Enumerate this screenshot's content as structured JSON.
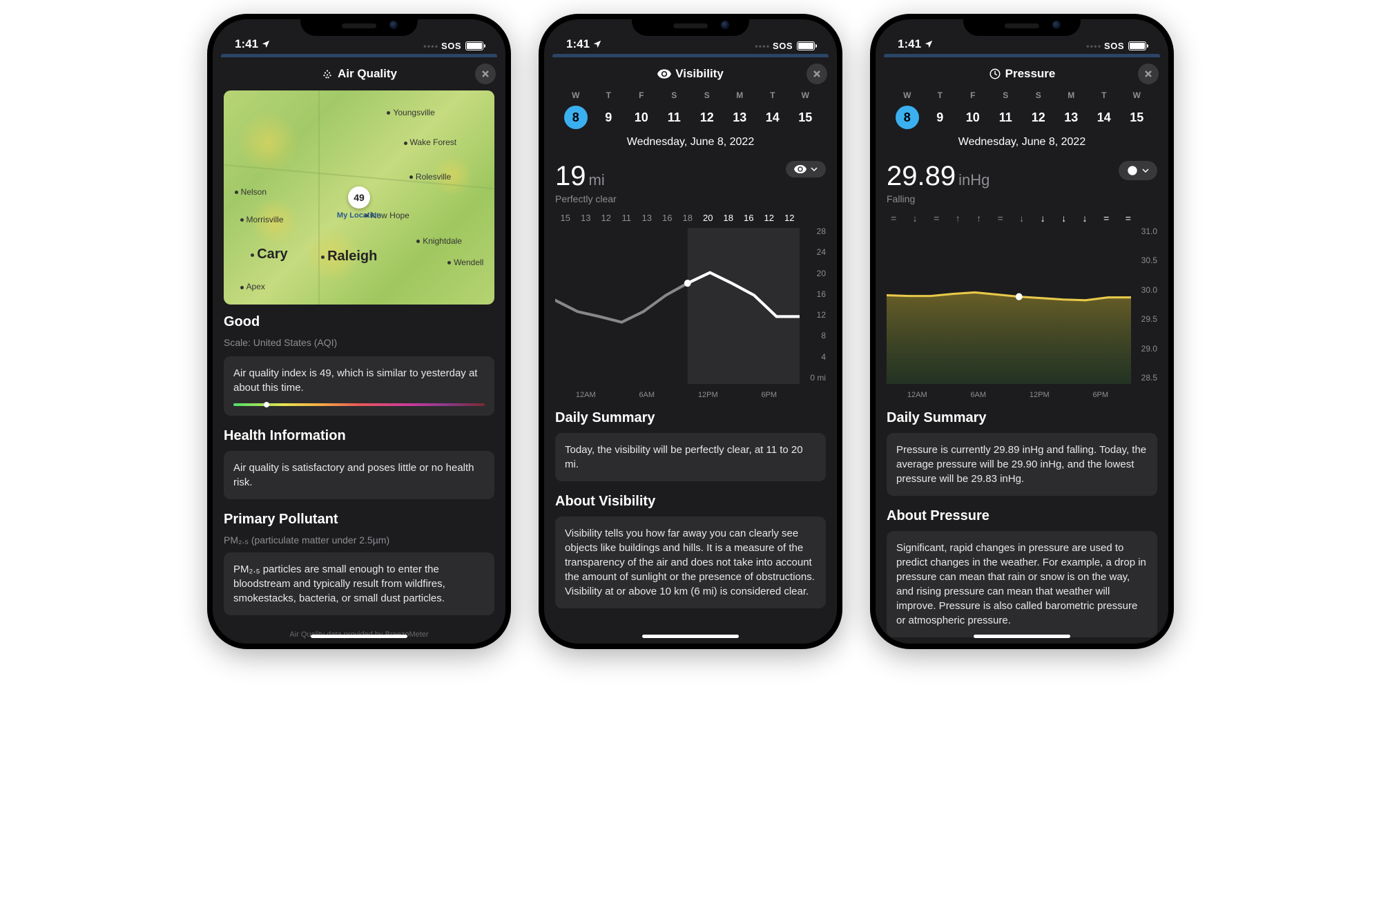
{
  "status_bar": {
    "time": "1:41",
    "sos": "SOS"
  },
  "days": {
    "labels": [
      "W",
      "T",
      "F",
      "S",
      "S",
      "M",
      "T",
      "W"
    ],
    "numbers": [
      "8",
      "9",
      "10",
      "11",
      "12",
      "13",
      "14",
      "15"
    ],
    "selected": 0,
    "date": "Wednesday, June 8, 2022"
  },
  "aqi": {
    "title": "Air Quality",
    "pin_value": "49",
    "pin_label": "My Location",
    "cities": [
      "Youngsville",
      "Wake Forest",
      "Rolesville",
      "Nelson",
      "Morrisville",
      "Cary",
      "Raleigh",
      "New Hope",
      "Knightdale",
      "Wendell",
      "Apex"
    ],
    "rating": "Good",
    "scale": "Scale: United States (AQI)",
    "summary": "Air quality index is 49, which is similar to yesterday at about this time.",
    "health_h": "Health Information",
    "health": "Air quality is satisfactory and poses little or no health risk.",
    "pollutant_h": "Primary Pollutant",
    "pollutant_sub": "PM₂.₅ (particulate matter under 2.5µm)",
    "pollutant": "PM₂.₅ particles are small enough to enter the bloodstream and typically result from wildfires, smokestacks, bacteria, or small dust particles.",
    "attribution": "Air Quality data provided by BreezoMeter"
  },
  "vis": {
    "title": "Visibility",
    "value": "19",
    "unit": "mi",
    "status": "Perfectly clear",
    "hours": [
      "15",
      "13",
      "12",
      "11",
      "13",
      "16",
      "18",
      "20",
      "18",
      "16",
      "12",
      "12"
    ],
    "yaxis": [
      "28",
      "24",
      "20",
      "16",
      "12",
      "8",
      "4",
      "0 mi"
    ],
    "xaxis": [
      "12AM",
      "6AM",
      "12PM",
      "6PM"
    ],
    "daily_h": "Daily Summary",
    "daily": "Today, the visibility will be perfectly clear, at 11 to 20 mi.",
    "about_h": "About Visibility",
    "about": "Visibility tells you how far away you can clearly see objects like buildings and hills. It is a measure of the transparency of the air and does not take into account the amount of sunlight or the presence of obstructions. Visibility at or above 10 km (6 mi) is considered clear."
  },
  "pres": {
    "title": "Pressure",
    "value": "29.89",
    "unit": "inHg",
    "status": "Falling",
    "trend": [
      "=",
      "↓",
      "=",
      "↑",
      "↑",
      "=",
      "↓",
      "↓",
      "↓",
      "↓",
      "=",
      "="
    ],
    "yaxis": [
      "31.0",
      "30.5",
      "30.0",
      "29.5",
      "29.0",
      "28.5"
    ],
    "xaxis": [
      "12AM",
      "6AM",
      "12PM",
      "6PM"
    ],
    "daily_h": "Daily Summary",
    "daily": "Pressure is currently 29.89 inHg and falling. Today, the average pressure will be 29.90 inHg, and the lowest pressure will be 29.83 inHg.",
    "about_h": "About Pressure",
    "about": "Significant, rapid changes in pressure are used to predict changes in the weather. For example, a drop in pressure can mean that rain or snow is on the way, and rising pressure can mean that weather will improve. Pressure is also called barometric pressure or atmospheric pressure."
  },
  "chart_data": [
    {
      "type": "line",
      "title": "Visibility",
      "x": [
        "12AM",
        "2AM",
        "4AM",
        "6AM",
        "8AM",
        "10AM",
        "12PM",
        "2PM",
        "4PM",
        "6PM",
        "8PM",
        "10PM"
      ],
      "values": [
        15,
        13,
        12,
        11,
        13,
        16,
        18,
        20,
        18,
        16,
        12,
        12
      ],
      "ylim": [
        0,
        28
      ],
      "ylabel": "mi",
      "now_index": 6
    },
    {
      "type": "line",
      "title": "Pressure",
      "x": [
        "12AM",
        "2AM",
        "4AM",
        "6AM",
        "8AM",
        "10AM",
        "12PM",
        "2PM",
        "4PM",
        "6PM",
        "8PM",
        "10PM"
      ],
      "values": [
        29.92,
        29.91,
        29.91,
        29.95,
        29.97,
        29.94,
        29.9,
        29.87,
        29.85,
        29.84,
        29.89,
        29.89
      ],
      "ylim": [
        28.5,
        31.0
      ],
      "ylabel": "inHg",
      "now_index": 6
    }
  ]
}
